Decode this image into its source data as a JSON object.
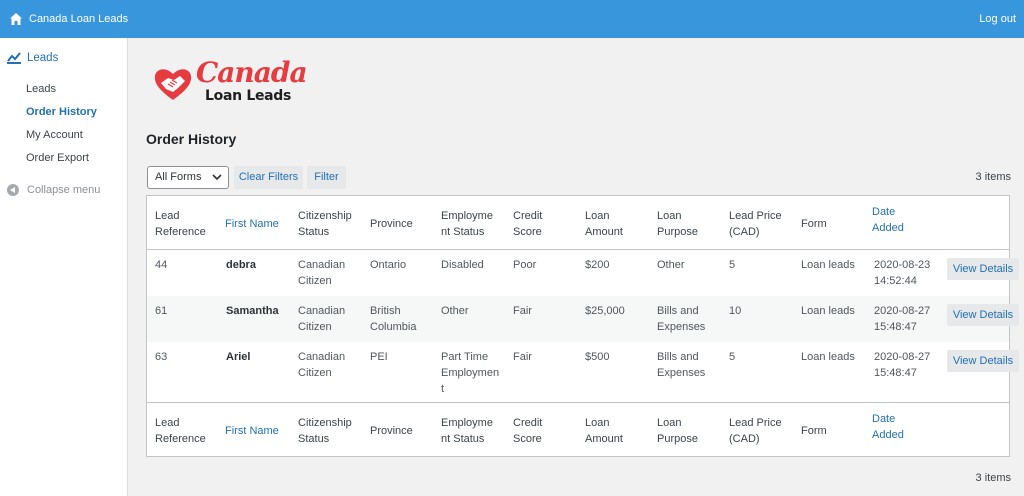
{
  "topbar": {
    "site_title": "Canada Loan Leads",
    "logout_label": "Log out"
  },
  "sidebar": {
    "menu_label": "Leads",
    "items": [
      {
        "label": "Leads",
        "current": false
      },
      {
        "label": "Order History",
        "current": true
      },
      {
        "label": "My Account",
        "current": false
      },
      {
        "label": "Order Export",
        "current": false
      }
    ],
    "collapse_label": "Collapse menu"
  },
  "logo": {
    "line1": "Canada",
    "line2": "Loan Leads"
  },
  "page_title": "Order History",
  "filters": {
    "form_select_value": "All Forms",
    "clear_label": "Clear Filters",
    "filter_label": "Filter"
  },
  "items_count": "3 items",
  "columns": [
    {
      "l1": "Lead",
      "l2": "Reference",
      "link": false
    },
    {
      "l1": "First Name",
      "l2": "",
      "link": true
    },
    {
      "l1": "Citizenship",
      "l2": "Status",
      "link": false
    },
    {
      "l1": "Province",
      "l2": "",
      "link": false
    },
    {
      "l1": "Employme",
      "l2": "nt Status",
      "link": false
    },
    {
      "l1": "Credit",
      "l2": "Score",
      "link": false
    },
    {
      "l1": "Loan",
      "l2": "Amount",
      "link": false
    },
    {
      "l1": "Loan",
      "l2": "Purpose",
      "link": false
    },
    {
      "l1": "Lead Price",
      "l2": "(CAD)",
      "link": false
    },
    {
      "l1": "Form",
      "l2": "",
      "link": false
    },
    {
      "l1": "Date",
      "l2": "Added",
      "link": true
    }
  ],
  "footer_columns": [
    {
      "l1": "Lead",
      "l2": "Reference"
    },
    {
      "l1": "First Name",
      "l2": ""
    },
    {
      "l1": "Citizenship",
      "l2": "Status"
    },
    {
      "l1": "Province",
      "l2": ""
    },
    {
      "l1": "Employme",
      "l2": "nt Status"
    },
    {
      "l1": "Credit",
      "l2": "Score"
    },
    {
      "l1": "Loan",
      "l2": "Amount"
    },
    {
      "l1": "Loan",
      "l2": "Purpose"
    },
    {
      "l1": "Lead Price",
      "l2": "(CAD)"
    },
    {
      "l1": "Form",
      "l2": ""
    },
    {
      "l1": "Date",
      "l2": "Added"
    }
  ],
  "rows": [
    {
      "ref": "44",
      "name": "debra",
      "citizenship": "Canadian\nCitizen",
      "province": "Ontario",
      "employment": "Disabled",
      "credit": "Poor",
      "amount": "$200",
      "purpose": "Other",
      "price": "5",
      "form": "Loan leads",
      "date": "2020-08-23\n14:52:44",
      "action": "View Details"
    },
    {
      "ref": "61",
      "name": "Samantha",
      "citizenship": "Canadian\nCitizen",
      "province": "British\nColumbia",
      "employment": "Other",
      "credit": "Fair",
      "amount": "$25,000",
      "purpose": "Bills and\nExpenses",
      "price": "10",
      "form": "Loan leads",
      "date": "2020-08-27\n15:48:47",
      "action": "View Details"
    },
    {
      "ref": "63",
      "name": "Ariel",
      "citizenship": "Canadian\nCitizen",
      "province": "PEI",
      "employment": "Part Time\nEmploymen\nt",
      "credit": "Fair",
      "amount": "$500",
      "purpose": "Bills and\nExpenses",
      "price": "5",
      "form": "Loan leads",
      "date": "2020-08-27\n15:48:47",
      "action": "View Details"
    }
  ],
  "colors": {
    "topbar": "#3896dd",
    "link": "#2271b1",
    "logo_red": "#e63b3f"
  }
}
